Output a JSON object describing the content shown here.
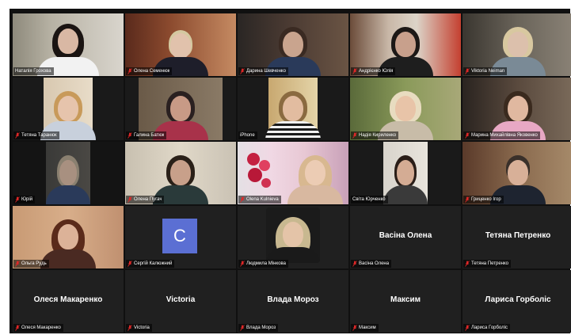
{
  "app": {
    "accent_active_border": "#b4d842",
    "muted_icon_color": "#e02828"
  },
  "participants": [
    {
      "name": "Наталія Грохова",
      "type": "video",
      "active": true,
      "muted": false
    },
    {
      "name": "Олена Семенюк",
      "type": "video",
      "muted": true
    },
    {
      "name": "Дарина Шевченко",
      "type": "video",
      "muted": true
    },
    {
      "name": "Андрієнко Юлія",
      "type": "video",
      "muted": true
    },
    {
      "name": "Viktoria Neiman",
      "type": "video",
      "muted": true
    },
    {
      "name": "Тетяна Таранюк",
      "type": "video",
      "muted": true
    },
    {
      "name": "Галина Батюк",
      "type": "video",
      "muted": true
    },
    {
      "name": "iPhone",
      "type": "video",
      "muted": false
    },
    {
      "name": "Надія Кириленко",
      "type": "video",
      "muted": true
    },
    {
      "name": "Марина Михайлівна Яковенко",
      "type": "video",
      "muted": true
    },
    {
      "name": "Юрій",
      "type": "video",
      "muted": true
    },
    {
      "name": "Олена Пугач",
      "type": "video",
      "muted": true
    },
    {
      "name": "Olena Kulnieva",
      "type": "video",
      "muted": true
    },
    {
      "name": "Світа Юрченко",
      "type": "video",
      "muted": false
    },
    {
      "name": "Гриценко Ігор",
      "type": "video",
      "muted": true
    },
    {
      "name": "Ольга Рудь",
      "type": "video",
      "muted": true
    },
    {
      "name": "Сергій Калюжний",
      "type": "avatar",
      "avatar_letter": "C",
      "muted": true
    },
    {
      "name": "Людмила Мінкова",
      "type": "photo",
      "muted": true
    },
    {
      "name": "Васіна Олена",
      "type": "nameonly",
      "display_name": "Васіна Олена",
      "muted": true
    },
    {
      "name": "Тетяна Петренко",
      "type": "nameonly",
      "display_name": "Тетяна Петренко",
      "muted": true
    },
    {
      "name": "Олеся Макаренко",
      "type": "nameonly",
      "display_name": "Олеся Макаренко",
      "muted": true
    },
    {
      "name": "Victoria",
      "type": "nameonly",
      "display_name": "Victoria",
      "muted": true
    },
    {
      "name": "Влада Мороз",
      "type": "nameonly",
      "display_name": "Влада Мороз",
      "muted": true
    },
    {
      "name": "Максим",
      "type": "nameonly",
      "display_name": "Максим",
      "muted": true
    },
    {
      "name": "Лариса Горболіс",
      "type": "nameonly",
      "display_name": "Лариса Горболіс",
      "muted": true
    }
  ]
}
